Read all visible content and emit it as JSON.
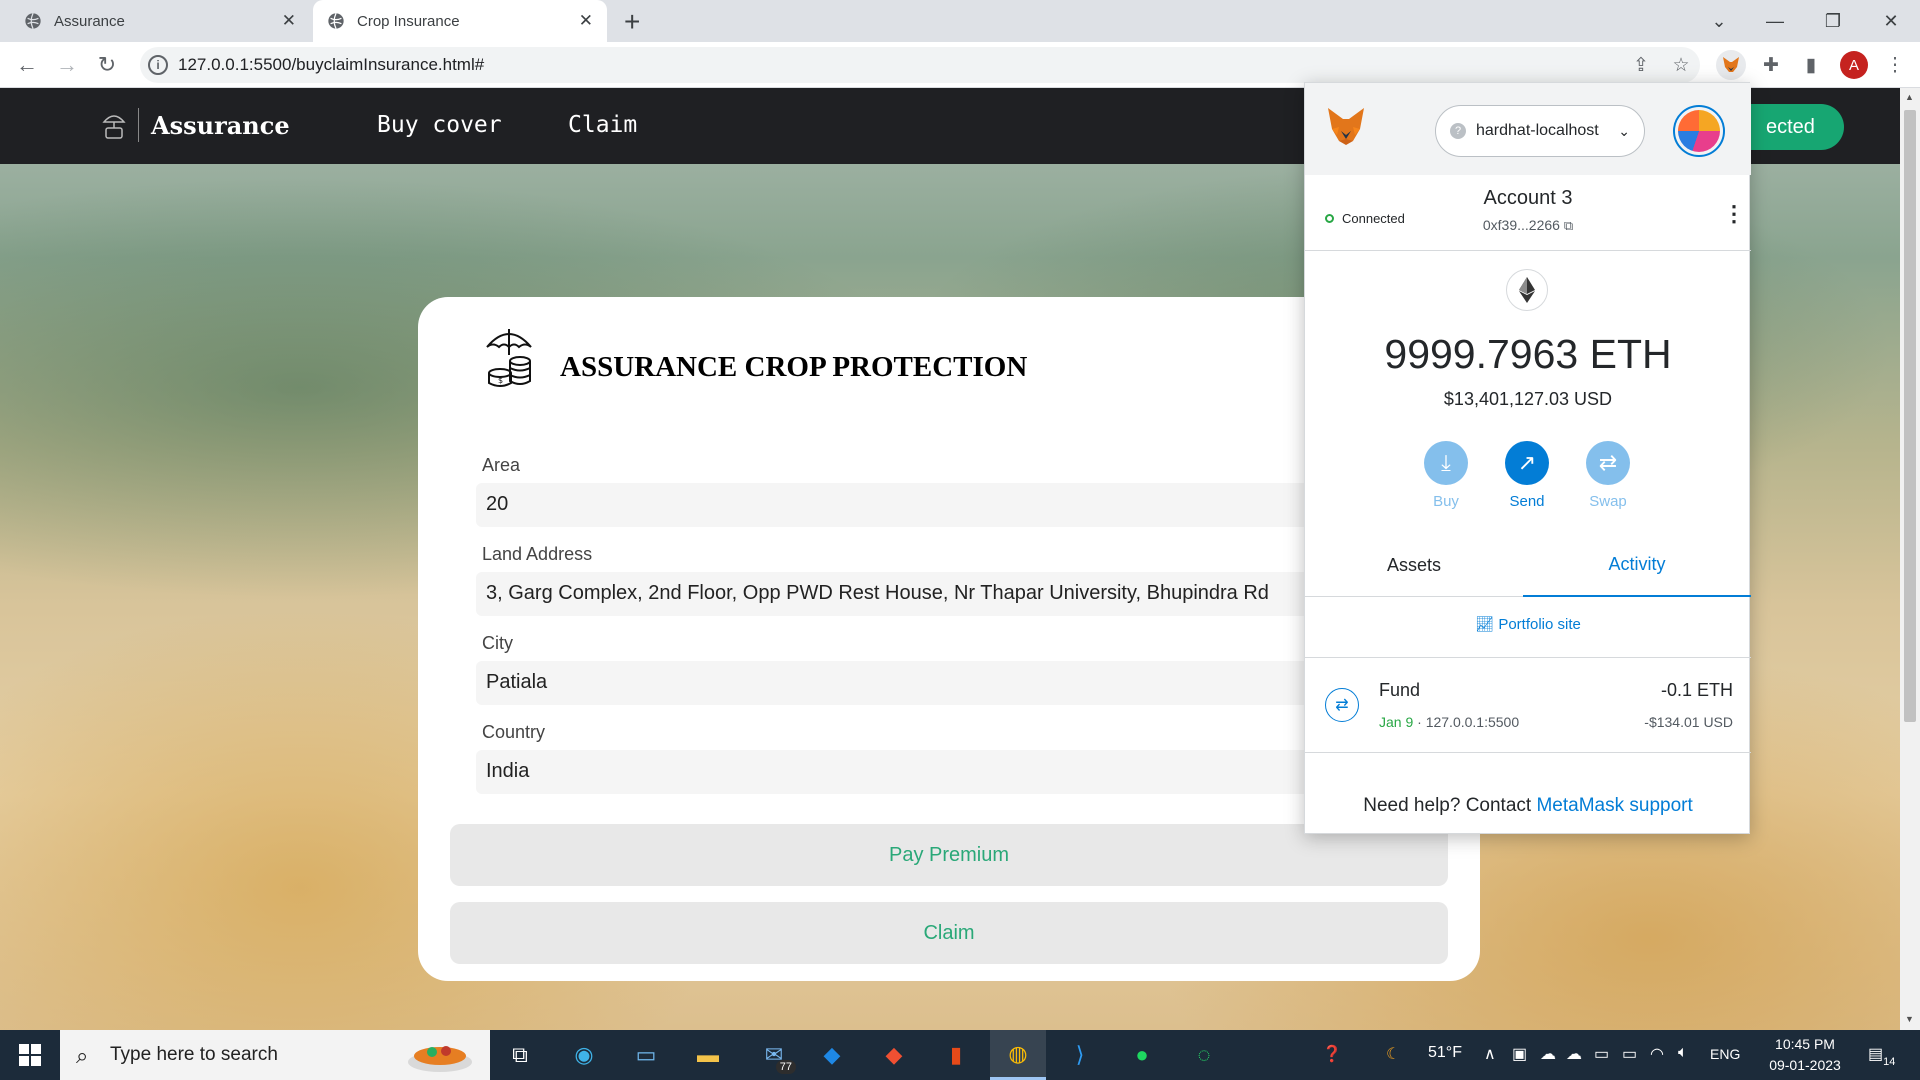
{
  "browser": {
    "tabs": [
      {
        "title": "Assurance"
      },
      {
        "title": "Crop Insurance"
      }
    ],
    "url": "127.0.0.1:5500/buyclaimInsurance.html#"
  },
  "site": {
    "brand": "Assurance",
    "nav": [
      "Buy cover",
      "Claim"
    ],
    "connect_button_partial": "ected",
    "form": {
      "title": "ASSURANCE CROP PROTECTION",
      "area_label": "Area",
      "area_value": "20",
      "address_label": "Land Address",
      "address_value": "3, Garg Complex, 2nd Floor, Opp PWD Rest House, Nr Thapar University, Bhupindra Rd",
      "city_label": "City",
      "city_value": "Patiala",
      "country_label": "Country",
      "country_value": "India",
      "pay_button": "Pay Premium",
      "claim_button": "Claim"
    }
  },
  "metamask": {
    "network": "hardhat-localhost",
    "status": "Connected",
    "account_name": "Account 3",
    "address": "0xf39...2266",
    "balance": "9999.7963 ETH",
    "balance_usd": "$13,401,127.03 USD",
    "actions": [
      "Buy",
      "Send",
      "Swap"
    ],
    "tabs": [
      "Assets",
      "Activity"
    ],
    "active_tab": "Activity",
    "portfolio_link": "Portfolio site",
    "transaction": {
      "name": "Fund",
      "date": "Jan 9",
      "origin": "127.0.0.1:5500",
      "amount": "-0.1 ETH",
      "amount_usd": "-$134.01 USD"
    },
    "help_text": "Need help? Contact ",
    "help_link": "MetaMask support"
  },
  "taskbar": {
    "search_placeholder": "Type here to search",
    "mail_badge": "77",
    "weather": "51°F",
    "language": "ENG",
    "time": "10:45 PM",
    "date": "09-01-2023",
    "notification_count": "14"
  },
  "colors": {
    "accent_green": "#17a672",
    "metamask_blue": "#037dd6",
    "nav_dark": "#1f2023"
  }
}
